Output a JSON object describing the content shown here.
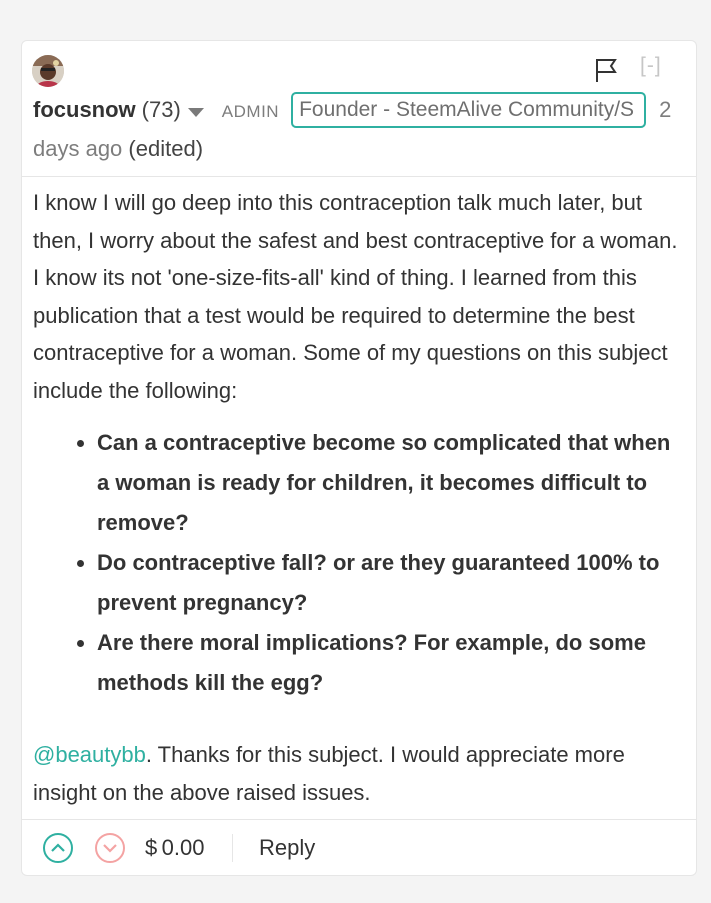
{
  "comment": {
    "author": "focusnow",
    "reputation": "(73)",
    "role": "ADMIN",
    "title_badge": "Founder - SteemAlive Community/S",
    "time_ago_start": "2",
    "time_ago_end": "days ago",
    "edited_label": "(edited)",
    "collapse_label": "[-]",
    "icons": {
      "avatar": "user-avatar",
      "flag": "flag-icon",
      "menu": "chevron-down-icon",
      "upvote": "chevron-up-icon",
      "downvote": "chevron-down-icon"
    },
    "body": {
      "intro": "I know I will go deep into this contraception talk much later, but then, I worry about the safest and best contraceptive for a woman. I know its not 'one-size-fits-all' kind of thing. I learned from this publication that a test would be required to determine the best contraceptive for a woman. Some of my questions on this subject include the following:",
      "questions": [
        "Can a contraceptive become so complicated that when a woman is ready for children, it becomes difficult to remove?",
        "Do contraceptive fall? or are they guaranteed 100% to prevent pregnancy?",
        "Are there moral implications? For example, do some methods kill the egg?"
      ],
      "mention": "@beautybb",
      "closing": ". Thanks for this subject. I would appreciate more insight on the above raised issues."
    },
    "footer": {
      "payout": "$ 0.00",
      "reply_label": "Reply"
    },
    "colors": {
      "accent": "#2fb0a1",
      "downvote": "#f4a3a3",
      "muted_text": "#7d7d7d",
      "border": "#e6e6e6"
    }
  }
}
